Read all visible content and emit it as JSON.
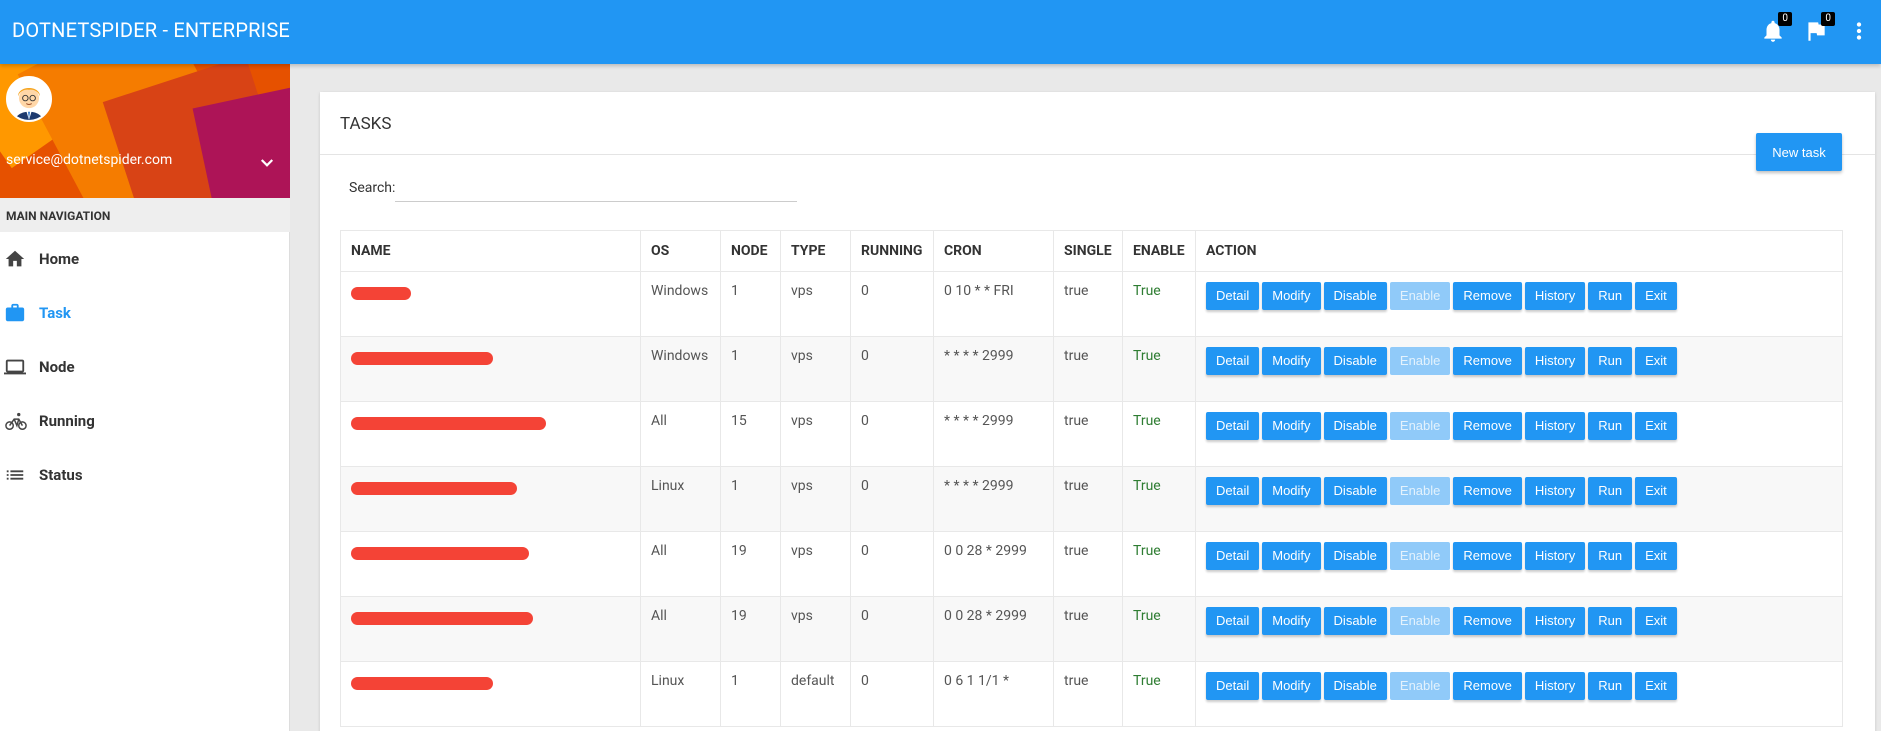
{
  "app": {
    "title": "DOTNETSPIDER - ENTERPRISE"
  },
  "topbar": {
    "notifications_count": "0",
    "flags_count": "0"
  },
  "profile": {
    "email": "service@dotnetspider.com"
  },
  "nav": {
    "header": "MAIN NAVIGATION",
    "items": [
      {
        "label": "Home",
        "icon": "home-icon"
      },
      {
        "label": "Task",
        "icon": "briefcase-icon",
        "active": true
      },
      {
        "label": "Node",
        "icon": "laptop-icon"
      },
      {
        "label": "Running",
        "icon": "bike-icon"
      },
      {
        "label": "Status",
        "icon": "list-icon"
      }
    ]
  },
  "tasks": {
    "title": "TASKS",
    "new_task_label": "New task",
    "search_label": "Search:",
    "search_value": "",
    "columns": [
      "NAME",
      "OS",
      "NODE",
      "TYPE",
      "RUNNING",
      "CRON",
      "SINGLE",
      "ENABLE",
      "ACTION"
    ],
    "rows": [
      {
        "os": "Windows",
        "node": "1",
        "type": "vps",
        "running": "0",
        "cron": "0 10 * * FRI",
        "single": "true",
        "enable": "True"
      },
      {
        "os": "Windows",
        "node": "1",
        "type": "vps",
        "running": "0",
        "cron": "* * * * 2999",
        "single": "true",
        "enable": "True"
      },
      {
        "os": "All",
        "node": "15",
        "type": "vps",
        "running": "0",
        "cron": "* * * * 2999",
        "single": "true",
        "enable": "True"
      },
      {
        "os": "Linux",
        "node": "1",
        "type": "vps",
        "running": "0",
        "cron": "* * * * 2999",
        "single": "true",
        "enable": "True"
      },
      {
        "os": "All",
        "node": "19",
        "type": "vps",
        "running": "0",
        "cron": "0 0 28 * 2999",
        "single": "true",
        "enable": "True"
      },
      {
        "os": "All",
        "node": "19",
        "type": "vps",
        "running": "0",
        "cron": "0 0 28 * 2999",
        "single": "true",
        "enable": "True"
      },
      {
        "os": "Linux",
        "node": "1",
        "type": "default",
        "running": "0",
        "cron": "0 6 1 1/1 *",
        "single": "true",
        "enable": "True"
      }
    ],
    "actions": [
      {
        "label": "Detail",
        "disabled": false
      },
      {
        "label": "Modify",
        "disabled": false
      },
      {
        "label": "Disable",
        "disabled": false
      },
      {
        "label": "Enable",
        "disabled": true
      },
      {
        "label": "Remove",
        "disabled": false
      },
      {
        "label": "History",
        "disabled": false
      },
      {
        "label": "Run",
        "disabled": false
      },
      {
        "label": "Exit",
        "disabled": false
      }
    ]
  },
  "colors": {
    "primary": "#2196f3",
    "primary_disabled": "#90caf9",
    "enable_text": "#2e7d32",
    "redaction": "#f44336"
  }
}
